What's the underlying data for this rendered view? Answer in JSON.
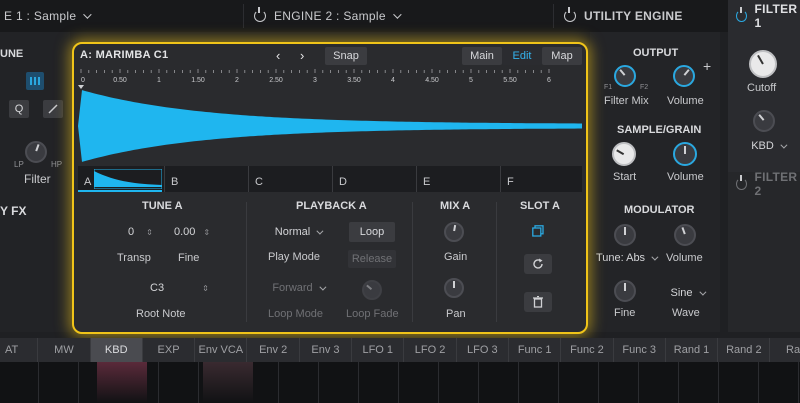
{
  "header": {
    "engine1": "E 1 : Sample",
    "engine2": "ENGINE 2 : Sample",
    "utility": "UTILITY ENGINE",
    "filter1": "FILTER 1",
    "filter2": "FILTER 2"
  },
  "left": {
    "title": "UNE",
    "q_label": "Q",
    "lp": "LP",
    "hp": "HP",
    "filter": "Filter",
    "fx": "Y FX"
  },
  "panel": {
    "title": "A: MARIMBA C1",
    "prev": "‹",
    "next": "›",
    "snap": "Snap",
    "tabs": [
      {
        "label": "Main",
        "active": false
      },
      {
        "label": "Edit",
        "active": true
      },
      {
        "label": "Map",
        "active": false
      }
    ],
    "ruler": [
      "0",
      "0.50",
      "1",
      "1.50",
      "2",
      "2.50",
      "3",
      "3.50",
      "4",
      "4.50",
      "5",
      "5.50",
      "6"
    ],
    "slots": [
      "A",
      "B",
      "C",
      "D",
      "E",
      "F"
    ],
    "waveform_color": "#1fb6ef"
  },
  "tune": {
    "title": "TUNE A",
    "transp_value": "0",
    "fine_value": "0.00",
    "transp_label": "Transp",
    "fine_label": "Fine",
    "root_value": "C3",
    "root_label": "Root Note"
  },
  "playback": {
    "title": "PLAYBACK A",
    "mode_value": "Normal",
    "mode_label": "Play Mode",
    "loop": "Loop",
    "release": "Release",
    "loopmode_value": "Forward",
    "loopmode_label": "Loop Mode",
    "loopfade_label": "Loop Fade"
  },
  "mix": {
    "title": "MIX A",
    "gain": "Gain",
    "pan": "Pan"
  },
  "slot": {
    "title": "SLOT A"
  },
  "utility": {
    "output": "OUTPUT",
    "f1": "F1",
    "f2": "F2",
    "filter_mix": "Filter Mix",
    "volume": "Volume",
    "plus": "+",
    "sample_grain": "SAMPLE/GRAIN",
    "start": "Start",
    "volume2": "Volume",
    "modulator": "MODULATOR",
    "tune_value": "Tune: Abs",
    "volume3": "Volume",
    "wave_value": "Sine",
    "fine": "Fine",
    "wave": "Wave"
  },
  "filter1": {
    "cutoff": "Cutoff",
    "kbd": "KBD"
  },
  "mod_tabs": [
    {
      "label": "AT",
      "selected": false
    },
    {
      "label": "MW",
      "selected": false
    },
    {
      "label": "KBD",
      "selected": true
    },
    {
      "label": "EXP",
      "selected": false
    },
    {
      "label": "Env VCA",
      "selected": false
    },
    {
      "label": "Env 2",
      "selected": false
    },
    {
      "label": "Env 3",
      "selected": false
    },
    {
      "label": "LFO 1",
      "selected": false
    },
    {
      "label": "LFO 2",
      "selected": false
    },
    {
      "label": "LFO 3",
      "selected": false
    },
    {
      "label": "Func 1",
      "selected": false
    },
    {
      "label": "Func 2",
      "selected": false
    },
    {
      "label": "Func 3",
      "selected": false
    },
    {
      "label": "Rand 1",
      "selected": false
    },
    {
      "label": "Rand 2",
      "selected": false
    },
    {
      "label": "Ran",
      "selected": false
    }
  ]
}
